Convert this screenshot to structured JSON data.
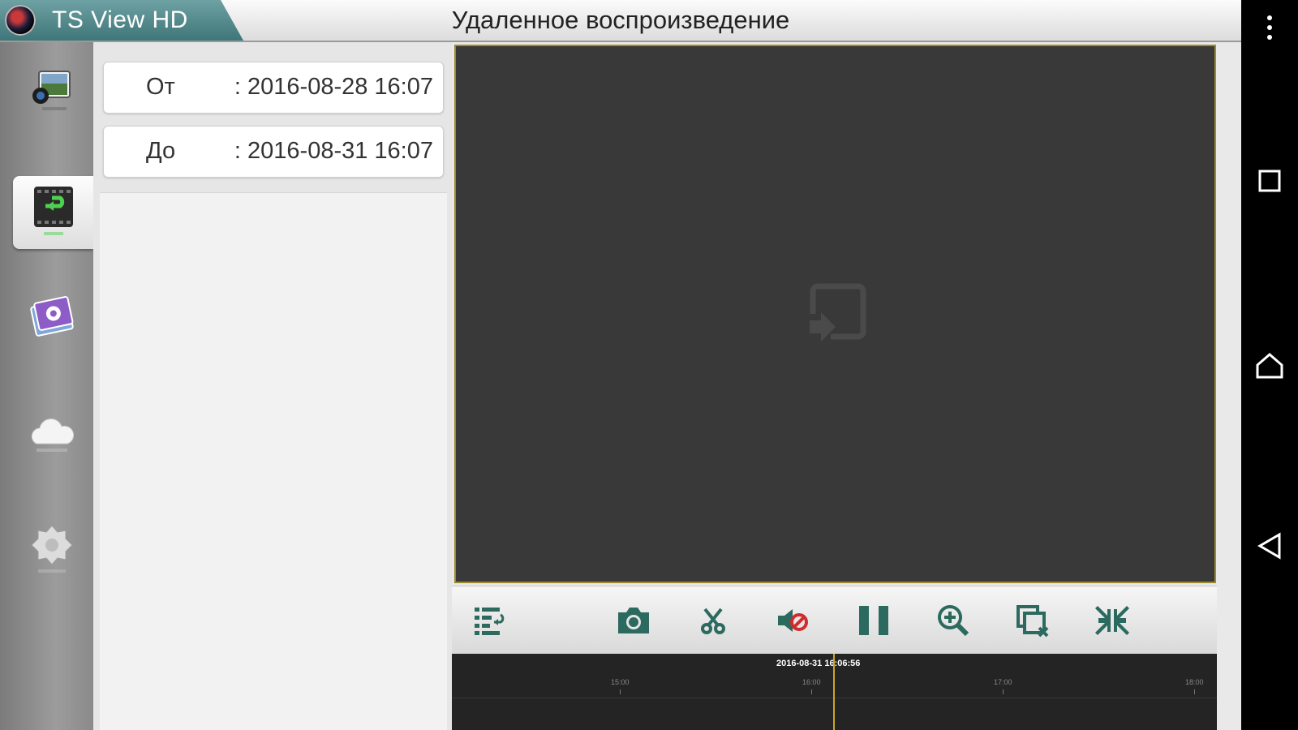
{
  "app": {
    "name": "TS View HD"
  },
  "header": {
    "title": "Удаленное воспроизведение"
  },
  "sidebar": {
    "items": [
      {
        "icon": "live-view-icon",
        "active": false
      },
      {
        "icon": "playback-icon",
        "active": true
      },
      {
        "icon": "gallery-icon",
        "active": false
      },
      {
        "icon": "cloud-icon",
        "active": false
      },
      {
        "icon": "settings-gear-icon",
        "active": false
      }
    ]
  },
  "search": {
    "from": {
      "label": "От",
      "value": ": 2016-08-28  16:07"
    },
    "to": {
      "label": "До",
      "value": ": 2016-08-31  16:07"
    }
  },
  "timeline": {
    "current": "2016-08-31 16:06:56",
    "ticks": [
      "15:00",
      "16:00",
      "17:00",
      "18:00"
    ]
  },
  "toolbar": {
    "buttons": [
      "channel-list-icon",
      "snapshot-icon",
      "clip-record-icon",
      "mute-icon",
      "pause-icon",
      "zoom-in-icon",
      "close-window-icon",
      "fullscreen-icon"
    ]
  },
  "colors": {
    "accent": "#3f7679",
    "highlight": "#c9a820",
    "iconGreen": "#2c6a5f",
    "mute": "#d12b2b"
  }
}
